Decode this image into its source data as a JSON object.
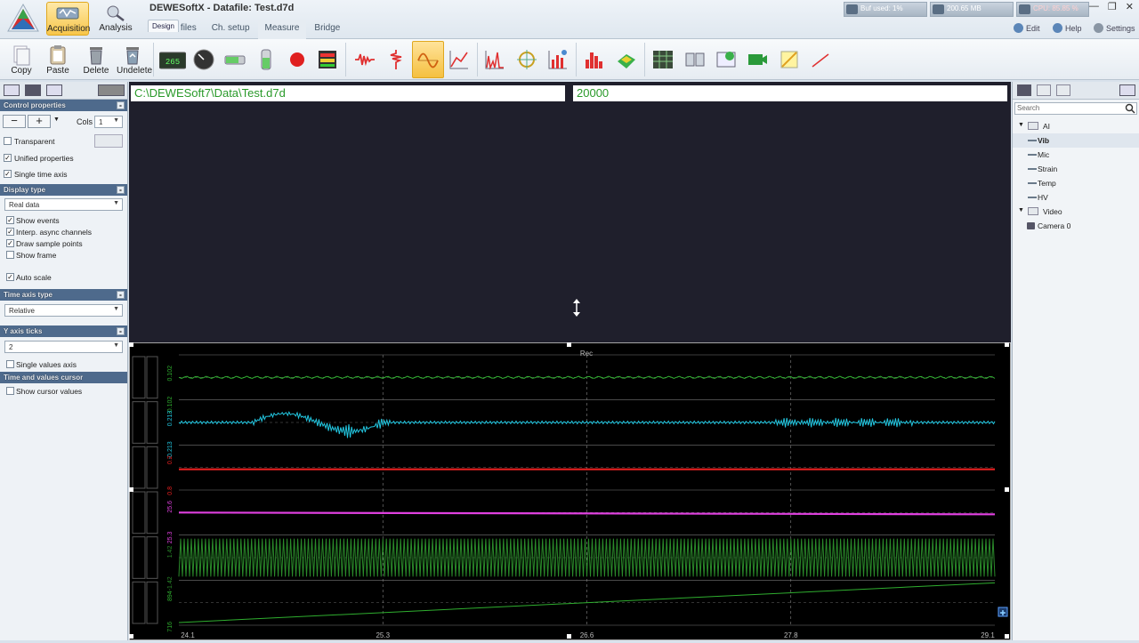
{
  "app": {
    "title": "DEWESoftX - Datafile: Test.d7d",
    "modes": [
      {
        "label": "Acquisition"
      },
      {
        "label": "Analysis"
      }
    ],
    "tabs": [
      "Setup files",
      "Ch. setup",
      "Measure",
      "Design",
      "Bridge"
    ],
    "selected_tab": "Design"
  },
  "status": {
    "buf_used": "Buf used: 1%",
    "memory": "200.65 MB",
    "cpu": "CPU: 85.85 %"
  },
  "top_right": {
    "edit": "Edit",
    "help": "Help",
    "settings": "Settings"
  },
  "toolbar": {
    "copy": "Copy",
    "paste": "Paste",
    "delete": "Delete",
    "undelete": "Undelete",
    "digital_value": "265"
  },
  "left_panel": {
    "control_properties": "Control properties",
    "cols_label": "Cols",
    "cols_value": "1",
    "transparent": "Transparent",
    "unified_properties": "Unified properties",
    "single_time_axis": "Single time axis",
    "display_type_header": "Display type",
    "display_type_value": "Real data",
    "show_events": "Show events",
    "interp_async": "Interp. async channels",
    "draw_sample_points": "Draw sample points",
    "show_frame": "Show frame",
    "auto_scale": "Auto scale",
    "time_axis_type_header": "Time axis type",
    "time_axis_type_value": "Relative",
    "y_axis_ticks_header": "Y axis ticks",
    "y_axis_ticks_value": "2",
    "single_values_axis": "Single values axis",
    "time_values_cursor_header": "Time and values cursor",
    "show_cursor_values": "Show cursor values"
  },
  "main": {
    "file_path": "C:\\DEWESoft7\\Data\\Test.d7d",
    "number_field": "20000",
    "rec_label": "Rec"
  },
  "right_panel": {
    "search_placeholder": "Search",
    "tree": [
      {
        "label": "AI",
        "type": "folder"
      },
      {
        "label": "Vib",
        "type": "item"
      },
      {
        "label": "Mic",
        "type": "item"
      },
      {
        "label": "Strain",
        "type": "item"
      },
      {
        "label": "Temp",
        "type": "item"
      },
      {
        "label": "HV",
        "type": "item"
      },
      {
        "label": "Video",
        "type": "folder"
      },
      {
        "label": "Camera 0",
        "type": "item"
      }
    ]
  },
  "chart_data": {
    "type": "line",
    "x_ticks": [
      "24.1",
      "25.3",
      "26.6",
      "27.8",
      "29.1"
    ],
    "series": [
      {
        "color": "#2fae2f",
        "axis_labels": [
          "0.102",
          "-0.102"
        ]
      },
      {
        "color": "#22c6e0",
        "axis_labels": [
          "0.213",
          "-0.213"
        ]
      },
      {
        "color": "#e82020",
        "axis_labels": [
          "0.2",
          "0.8"
        ]
      },
      {
        "color": "#e040e0",
        "axis_labels": [
          "25.6",
          "25.3"
        ]
      },
      {
        "color": "#2a8a2a",
        "axis_labels": [
          "1.42",
          "-1.42"
        ]
      },
      {
        "color": "#2fae2f",
        "axis_labels": [
          "894",
          "716"
        ]
      }
    ],
    "grid": true
  },
  "colors": {
    "accent": "#4e6a8c",
    "background": "#1f1f2c",
    "path_text": "#2a9a2a"
  }
}
